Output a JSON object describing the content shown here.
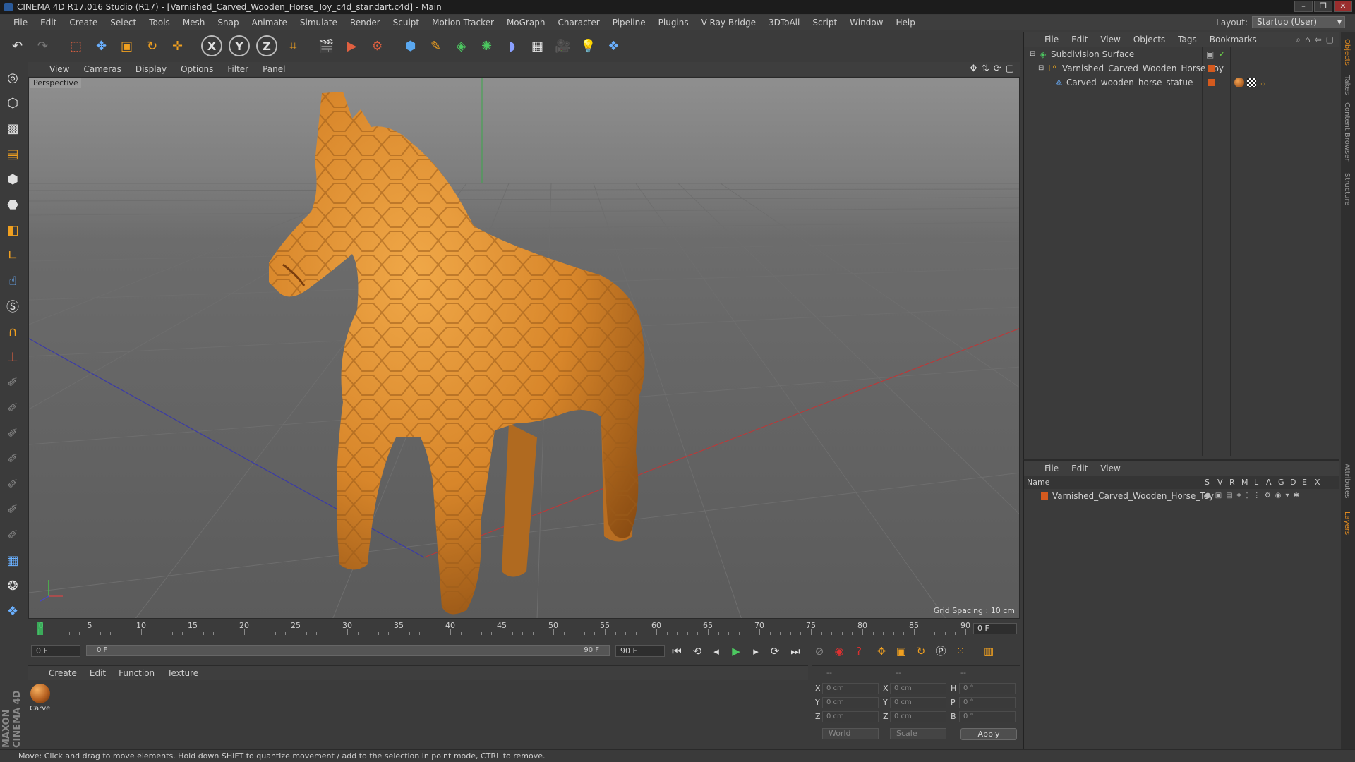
{
  "window": {
    "title": "CINEMA 4D R17.016 Studio (R17) - [Varnished_Carved_Wooden_Horse_Toy_c4d_standart.c4d] - Main"
  },
  "menubar": [
    "File",
    "Edit",
    "Create",
    "Select",
    "Tools",
    "Mesh",
    "Snap",
    "Animate",
    "Simulate",
    "Render",
    "Sculpt",
    "Motion Tracker",
    "MoGraph",
    "Character",
    "Pipeline",
    "Plugins",
    "V-Ray Bridge",
    "3DToAll",
    "Script",
    "Window",
    "Help"
  ],
  "layout": {
    "label": "Layout:",
    "value": "Startup (User)"
  },
  "viewport": {
    "menu": [
      "View",
      "Cameras",
      "Display",
      "Options",
      "Filter",
      "Panel"
    ],
    "label": "Perspective",
    "grid_spacing": "Grid Spacing : 10 cm"
  },
  "object_manager": {
    "menu": [
      "File",
      "Edit",
      "View",
      "Objects",
      "Tags",
      "Bookmarks"
    ],
    "objects": [
      {
        "name": "Subdivision Surface",
        "indent": 0
      },
      {
        "name": "Varnished_Carved_Wooden_Horse_Toy",
        "indent": 1
      },
      {
        "name": "Carved_wooden_horse_statue",
        "indent": 2
      }
    ]
  },
  "layer_manager": {
    "menu": [
      "File",
      "Edit",
      "View"
    ],
    "columns": [
      "Name",
      "S",
      "V",
      "R",
      "M",
      "L",
      "A",
      "G",
      "D",
      "E",
      "X"
    ],
    "layers": [
      {
        "name": "Varnished_Carved_Wooden_Horse_Toy"
      }
    ]
  },
  "right_tabs": [
    "Objects",
    "Takes",
    "Content Browser",
    "Structure",
    "Attributes",
    "Layers"
  ],
  "timeline": {
    "labels": [
      "0",
      "5",
      "10",
      "15",
      "20",
      "25",
      "30",
      "35",
      "40",
      "45",
      "50",
      "55",
      "60",
      "65",
      "70",
      "75",
      "80",
      "85",
      "90"
    ],
    "end_frame": "0 F",
    "current_frame": "0 F",
    "range_start": "0 F",
    "range_end": "90 F",
    "max_frame": "90 F"
  },
  "material_manager": {
    "menu": [
      "Create",
      "Edit",
      "Function",
      "Texture"
    ],
    "materials": [
      {
        "name": "Carve"
      }
    ]
  },
  "coordinates": {
    "headers": [
      "--",
      "--",
      "--"
    ],
    "pos": [
      {
        "axis": "X",
        "value": "0 cm"
      },
      {
        "axis": "Y",
        "value": "0 cm"
      },
      {
        "axis": "Z",
        "value": "0 cm"
      }
    ],
    "size": [
      {
        "axis": "X",
        "value": "0 cm"
      },
      {
        "axis": "Y",
        "value": "0 cm"
      },
      {
        "axis": "Z",
        "value": "0 cm"
      }
    ],
    "rot": [
      {
        "axis": "H",
        "value": "0 °"
      },
      {
        "axis": "P",
        "value": "0 °"
      },
      {
        "axis": "B",
        "value": "0 °"
      }
    ],
    "space": "World",
    "mode": "Scale",
    "apply": "Apply"
  },
  "statusbar": "Move: Click and drag to move elements. Hold down SHIFT to quantize movement / add to the selection in point mode, CTRL to remove.",
  "brand": "MAXON CINEMA 4D",
  "colors": {
    "accent": "#e08a20",
    "layer_color": "#d45a1e",
    "background": "#3b3b3b"
  }
}
